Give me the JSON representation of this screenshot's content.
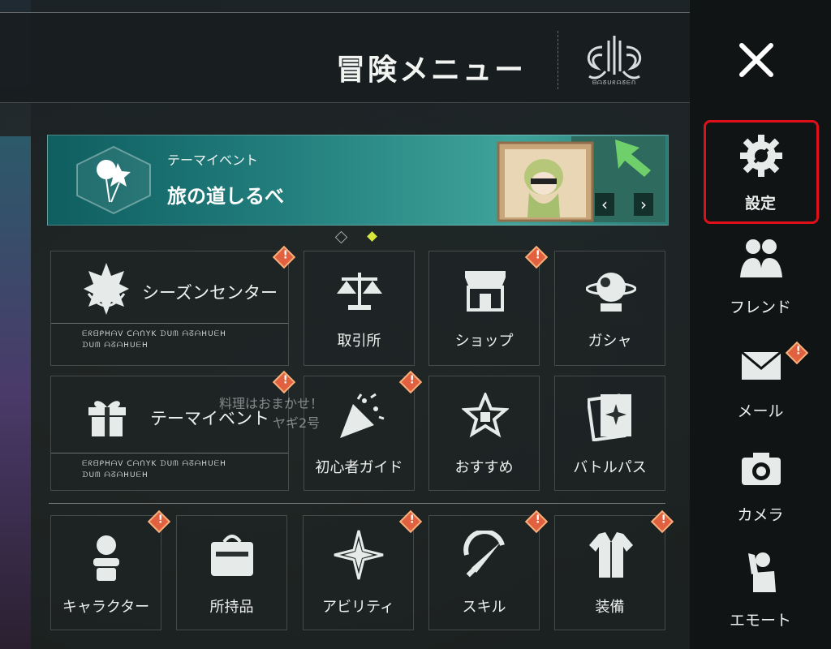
{
  "header": {
    "title": "冒険メニュー",
    "emblem_text": "ᗺᗩᘔᑌᖇᗩᘔᗴᑎ"
  },
  "close": {
    "icon": "close-icon"
  },
  "banner": {
    "subtitle": "テーマイベント",
    "title": "旅の道しるべ",
    "prev": "‹",
    "next": "›"
  },
  "pager": {
    "count": 2,
    "active": 1
  },
  "overlay": {
    "line1": "料理はおまかせ！",
    "line2": "ヤギ2号"
  },
  "big_tiles": [
    {
      "label": "シーズンセンター",
      "cipher1": "ᗴᖇᗺᑭᕼᗩᐯ ᑕᗩᑎYK ᗪᑌᗰ ᗩᘔᗩᕼᑌᗴᕼ",
      "cipher2": "ᗪᑌᗰ ᗩᘔᗩᕼᑌᗴᕼ"
    },
    {
      "label": "テーマイベント",
      "cipher1": "ᗴᖇᗺᑭᕼᗩᐯ ᑕᗩᑎYK ᗪᑌᗰ ᗩᘔᗩᕼᑌᗴᕼ",
      "cipher2": "ᗪᑌᗰ ᗩᘔᗩᕼᑌᗴᕼ"
    }
  ],
  "row1": [
    {
      "label": "取引所"
    },
    {
      "label": "ショップ"
    },
    {
      "label": "ガシャ"
    }
  ],
  "row2": [
    {
      "label": "初心者ガイド"
    },
    {
      "label": "おすすめ"
    },
    {
      "label": "バトルパス"
    }
  ],
  "row3": [
    {
      "label": "キャラクター"
    },
    {
      "label": "所持品"
    },
    {
      "label": "アビリティ"
    },
    {
      "label": "スキル"
    },
    {
      "label": "装備"
    }
  ],
  "badge_mark": "!",
  "sidebar": {
    "items": [
      {
        "label": "設定",
        "icon": "gear-wrench-icon"
      },
      {
        "label": "フレンド",
        "icon": "friends-icon"
      },
      {
        "label": "メール",
        "icon": "mail-icon"
      },
      {
        "label": "カメラ",
        "icon": "camera-icon"
      },
      {
        "label": "エモート",
        "icon": "emote-icon"
      }
    ]
  },
  "colors": {
    "alert": "#e0603f",
    "highlight": "#e0101a",
    "pager_active": "#d8e83a"
  }
}
